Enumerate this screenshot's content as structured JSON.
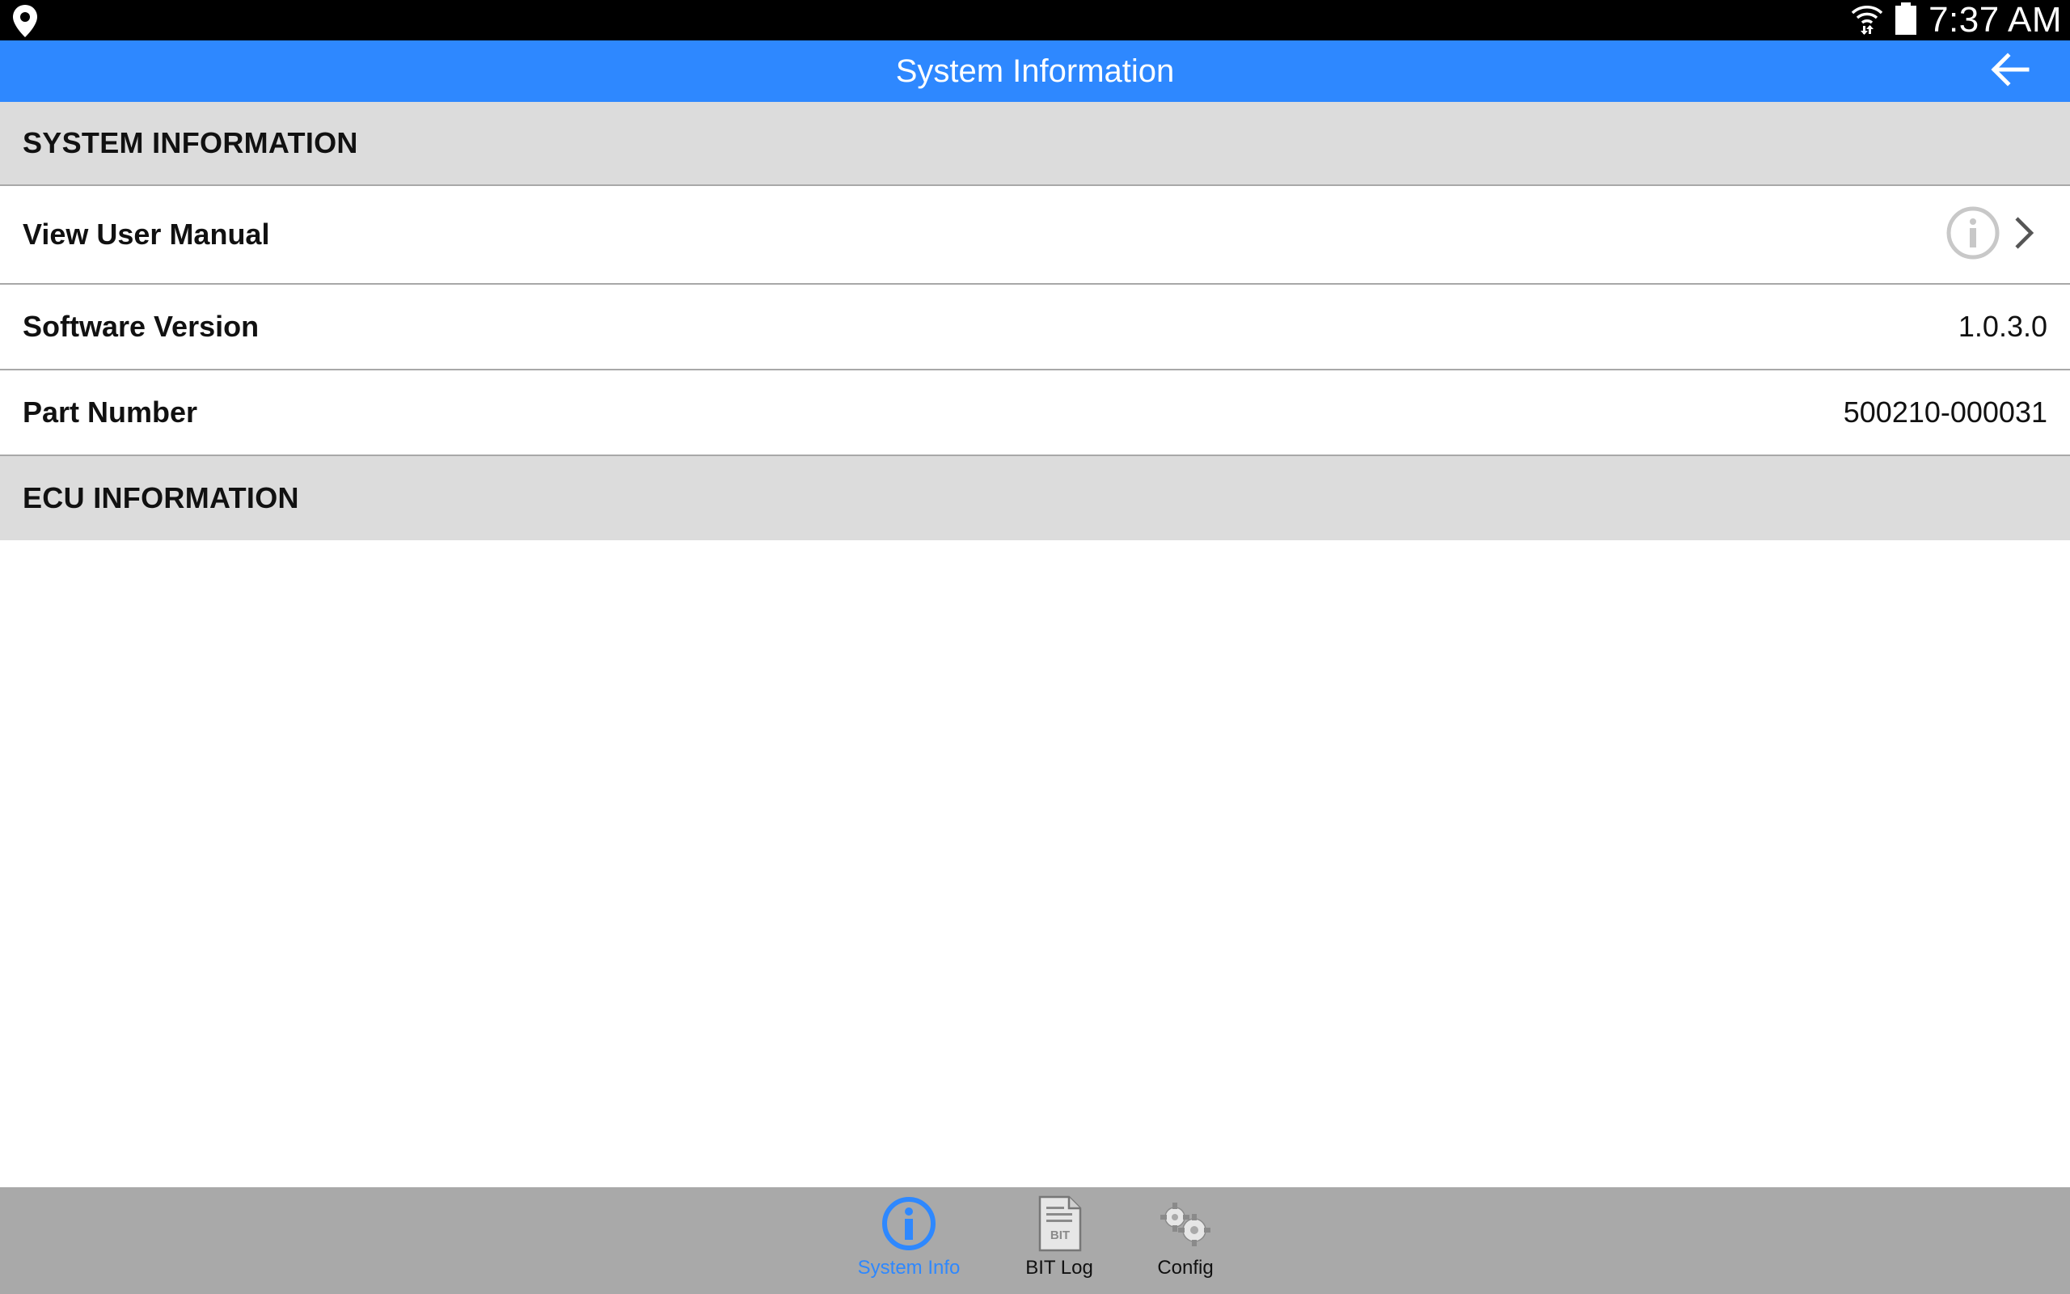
{
  "status_bar": {
    "time": "7:37 AM",
    "icons": [
      "location-pin-icon",
      "wifi-icon",
      "battery-icon"
    ]
  },
  "title_bar": {
    "title": "System Information",
    "back_icon": "back-arrow-icon"
  },
  "sections": {
    "system_information": {
      "header": "SYSTEM INFORMATION",
      "rows": {
        "user_manual": {
          "label": "View User Manual"
        },
        "software_version": {
          "label": "Software Version",
          "value": "1.0.3.0"
        },
        "part_number": {
          "label": "Part Number",
          "value": "500210-000031"
        }
      }
    },
    "ecu_information": {
      "header": "ECU INFORMATION"
    }
  },
  "tabs": {
    "system_info": {
      "label": "System Info",
      "icon": "info-circle-icon",
      "active": true
    },
    "bit_log": {
      "label": "BIT Log",
      "icon": "document-icon",
      "icon_text": "BIT"
    },
    "config": {
      "label": "Config",
      "icon": "gears-icon"
    }
  },
  "colors": {
    "accent": "#2e88ff",
    "status_bar": "#000000",
    "section_header_bg": "#dcdcdc",
    "tab_bar_bg": "#a9a9a9"
  }
}
